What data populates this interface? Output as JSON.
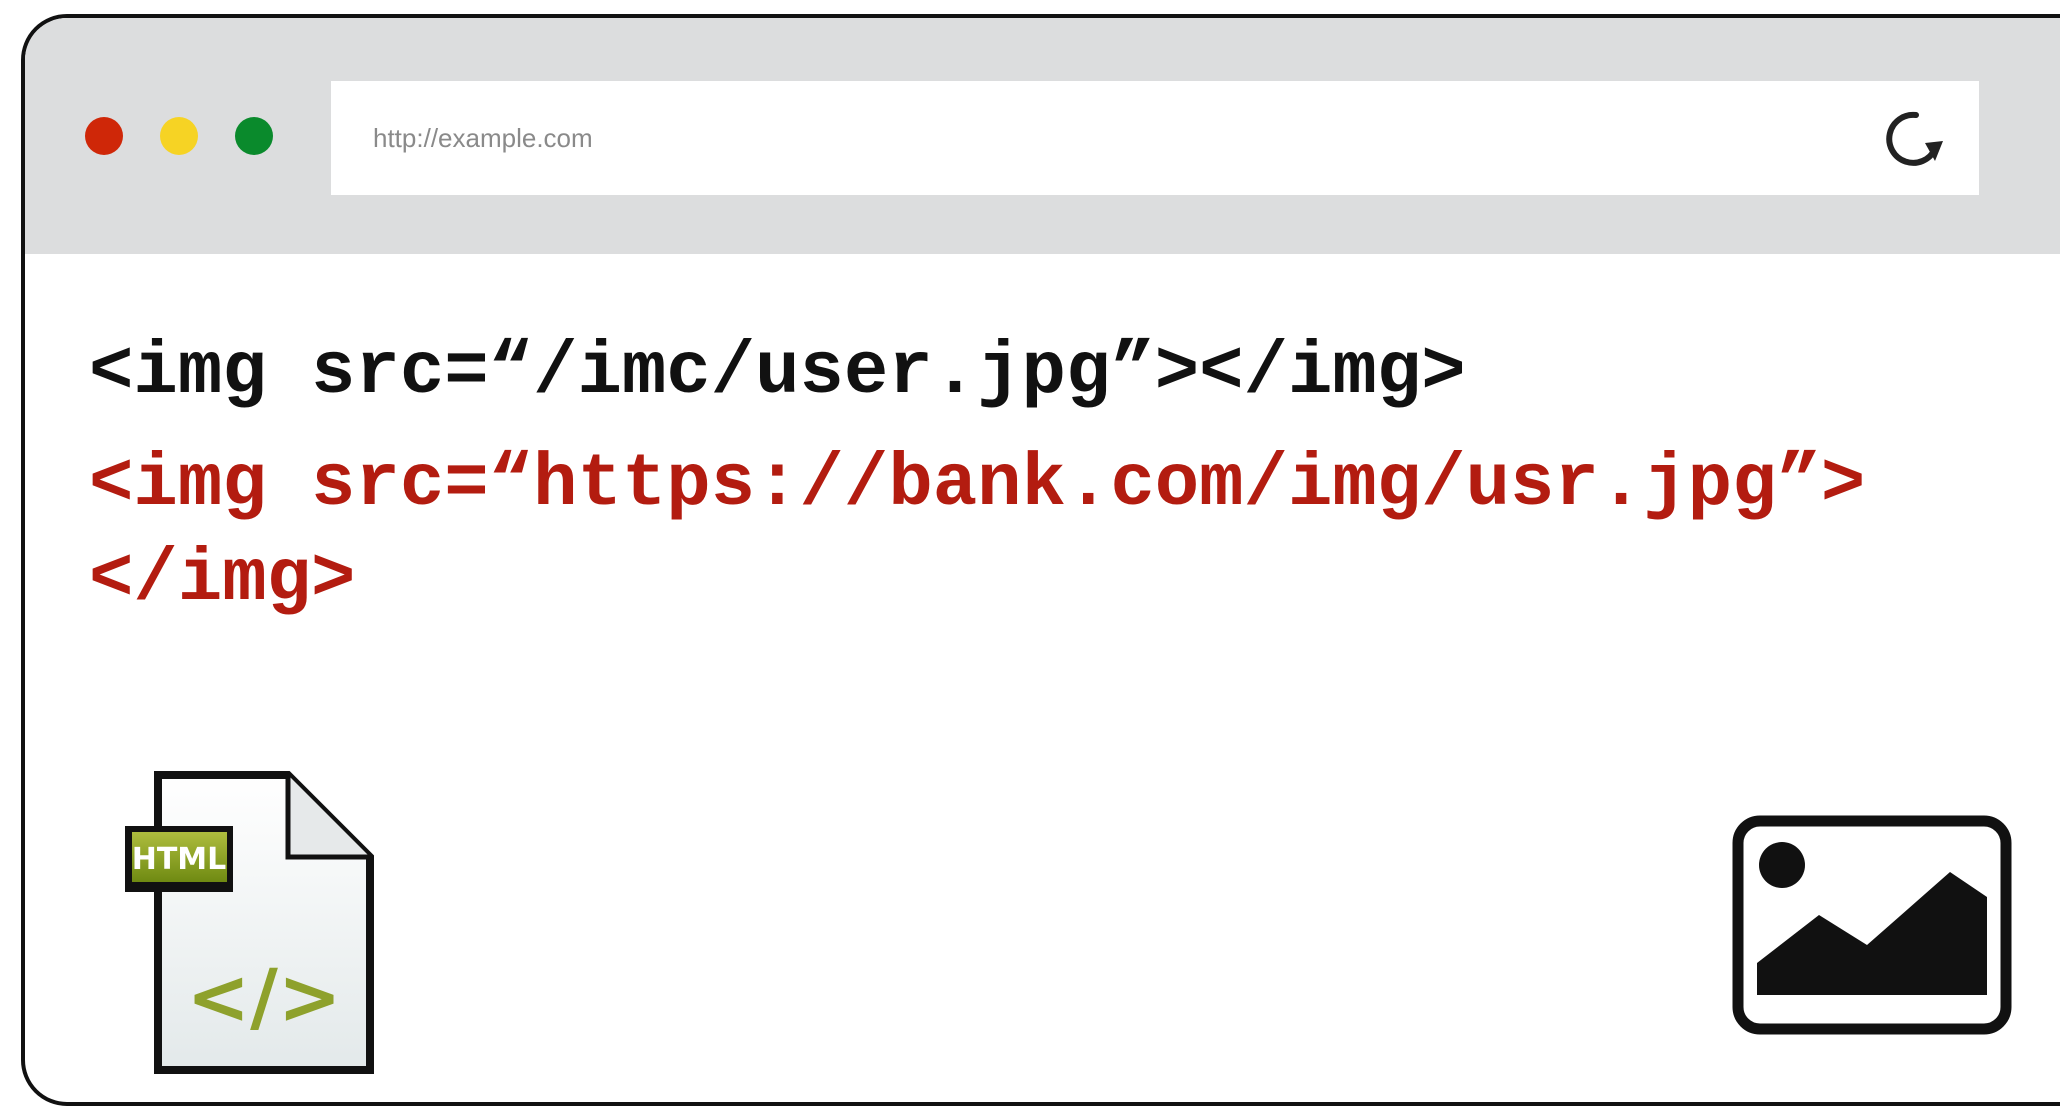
{
  "colors": {
    "red_dot": "#cf2708",
    "yellow_dot": "#f6d324",
    "green_dot": "#0a8a2c",
    "accent": "#b31c10"
  },
  "browser": {
    "address_bar": {
      "url": "http://example.com"
    },
    "reload_icon": "reload-icon"
  },
  "content": {
    "code_lines": [
      "<img src=“/imc/user.jpg”></img>",
      "<img src=“https://bank.com/img/usr.jpg”>",
      "</img>"
    ],
    "file_icon": {
      "badge_label": "HTML",
      "glyph": "</>"
    },
    "image_icon": "image-icon"
  }
}
